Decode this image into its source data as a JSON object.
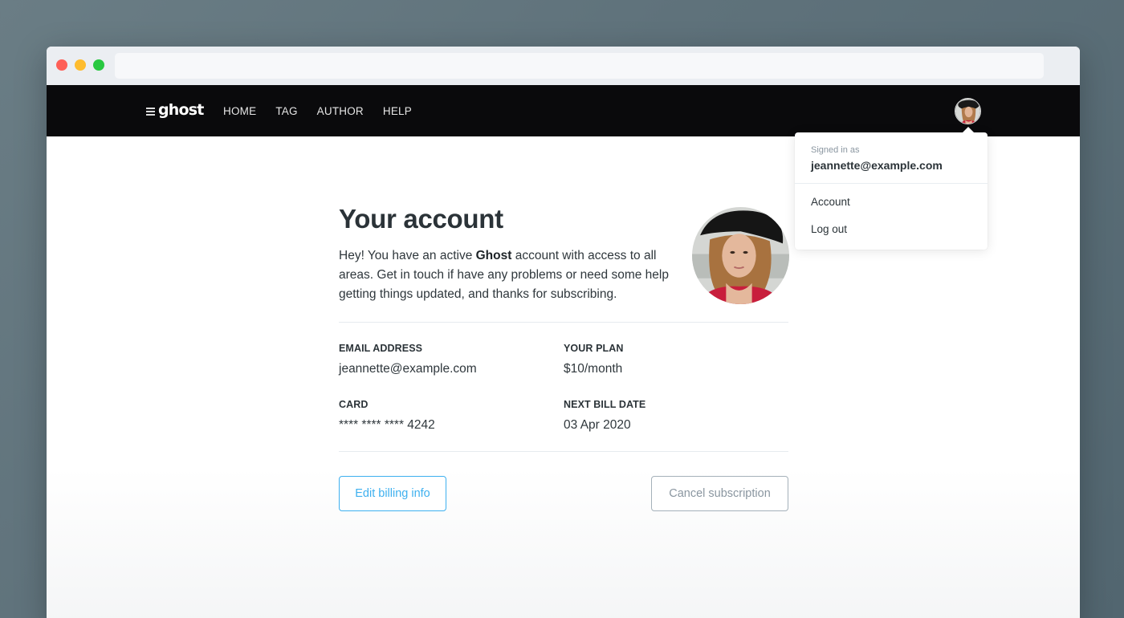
{
  "browser": {
    "controls": [
      "close",
      "minimize",
      "maximize"
    ],
    "url": ""
  },
  "nav": {
    "logo_text": "ghost",
    "links": [
      {
        "label": "HOME"
      },
      {
        "label": "TAG"
      },
      {
        "label": "AUTHOR"
      },
      {
        "label": "HELP"
      }
    ],
    "avatar_icon": "user-avatar"
  },
  "dropdown": {
    "signed_in_label": "Signed in as",
    "email": "jeannette@example.com",
    "items": [
      {
        "label": "Account"
      },
      {
        "label": "Log out"
      }
    ]
  },
  "account": {
    "title": "Your account",
    "intro_before": "Hey! You have an active ",
    "intro_bold": "Ghost",
    "intro_after": " account with access to all areas. Get in touch if have any problems or need some help getting things updated, and thanks for subscribing.",
    "fields": {
      "email_label": "EMAIL ADDRESS",
      "email_value": "jeannette@example.com",
      "plan_label": "YOUR PLAN",
      "plan_value": "$10/month",
      "card_label": "CARD",
      "card_value": "**** **** **** 4242",
      "bill_label": "NEXT BILL DATE",
      "bill_value": "03 Apr 2020"
    },
    "buttons": {
      "edit": "Edit billing info",
      "cancel": "Cancel subscription"
    }
  },
  "colors": {
    "accent": "#3eb0ef",
    "navbar": "#0a0a0c",
    "text": "#2b3338",
    "muted": "#8a96a0"
  }
}
